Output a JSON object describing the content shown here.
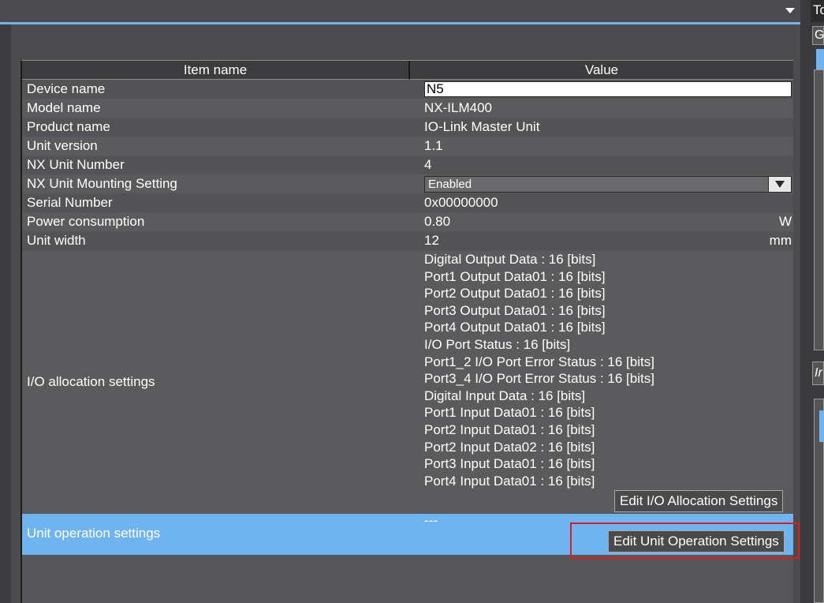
{
  "header": {
    "item_col": "Item name",
    "value_col": "Value"
  },
  "rows": [
    {
      "name": "Device name",
      "value": "N5"
    },
    {
      "name": "Model name",
      "value": "NX-ILM400"
    },
    {
      "name": "Product name",
      "value": "IO-Link Master Unit"
    },
    {
      "name": "Unit version",
      "value": "1.1"
    },
    {
      "name": "NX Unit Number",
      "value": "4"
    },
    {
      "name": "NX Unit Mounting Setting",
      "value": "Enabled"
    },
    {
      "name": "Serial Number",
      "value": "0x00000000"
    },
    {
      "name": "Power consumption",
      "value": "0.80",
      "unit": "W"
    },
    {
      "name": "Unit width",
      "value": "12",
      "unit": "mm"
    }
  ],
  "io_allocation": {
    "name": "I/O allocation settings",
    "entries": [
      "Digital Output Data : 16 [bits]",
      "Port1 Output Data01 : 16 [bits]",
      "Port2 Output Data01 : 16 [bits]",
      "Port3 Output Data01 : 16 [bits]",
      "Port4 Output Data01 : 16 [bits]",
      "I/O Port Status : 16 [bits]",
      "Port1_2 I/O Port Error Status : 16 [bits]",
      "Port3_4 I/O Port Error Status : 16 [bits]",
      "Digital Input Data : 16 [bits]",
      "Port1 Input Data01 : 16 [bits]",
      "Port2 Input Data01 : 16 [bits]",
      "Port2 Input Data02 : 16 [bits]",
      "Port3 Input Data01 : 16 [bits]",
      "Port4 Input Data01 : 16 [bits]"
    ],
    "edit_button": "Edit I/O Allocation Settings"
  },
  "unit_operation": {
    "name": "Unit operation settings",
    "value": "---",
    "edit_button": "Edit Unit Operation Settings"
  },
  "right_panel": {
    "top_label": "To",
    "tab_label": "G",
    "box_label": "Ir"
  },
  "colors": {
    "accent": "#6fb4ee",
    "highlight": "#d81e1e"
  }
}
